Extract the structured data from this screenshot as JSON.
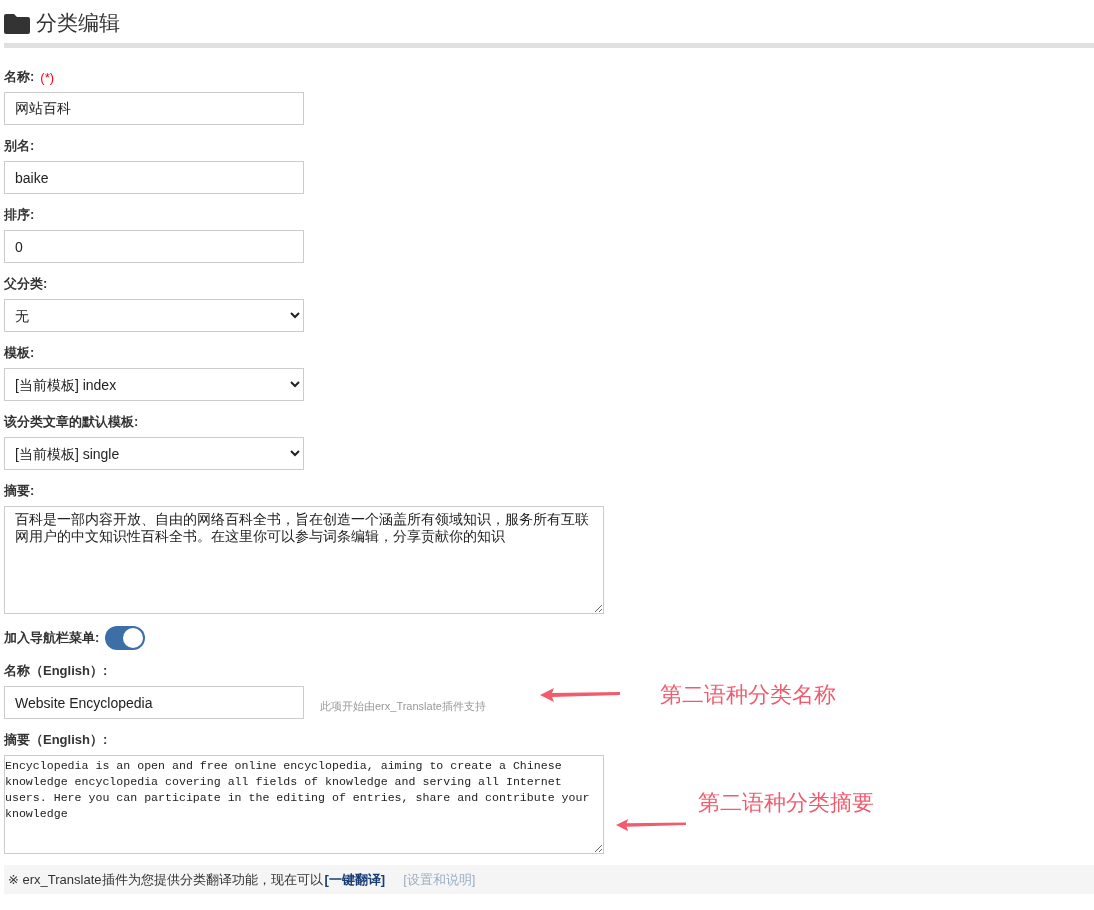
{
  "page_title": "分类编辑",
  "fields": [
    {
      "kind": "input",
      "label": "名称:",
      "required_mark": "(*)",
      "value": "网站百科"
    },
    {
      "kind": "input",
      "label": "别名:",
      "value": "baike"
    },
    {
      "kind": "input",
      "label": "排序:",
      "value": "0"
    },
    {
      "kind": "select",
      "label": "父分类:",
      "value": "无"
    },
    {
      "kind": "select",
      "label": "模板:",
      "value": "[当前模板] index"
    },
    {
      "kind": "select",
      "label": "该分类文章的默认模板:",
      "value": "[当前模板] single"
    },
    {
      "kind": "textarea",
      "label": "摘要:",
      "value": "百科是一部内容开放、自由的网络百科全书，旨在创造一个涵盖所有领域知识，服务所有互联网用户的中文知识性百科全书。在这里你可以参与词条编辑，分享贡献你的知识"
    },
    {
      "kind": "toggle",
      "label": "加入导航栏菜单:",
      "on": true
    },
    {
      "kind": "input",
      "label": "名称（English）:",
      "value": "Website Encyclopedia",
      "hint": "此项开始由erx_Translate插件支持"
    },
    {
      "kind": "mono",
      "label": "摘要（English）:",
      "value": "Encyclopedia is an open and free online encyclopedia, aiming to create a Chinese knowledge encyclopedia covering all fields of knowledge and serving all Internet users. Here you can participate in the editing of entries, share and contribute your knowledge"
    }
  ],
  "annotations": [
    {
      "text": "第二语种分类名称"
    },
    {
      "text": "第二语种分类摘要"
    }
  ],
  "footer": {
    "note": "※ erx_Translate插件为您提供分类翻译功能，现在可以",
    "translate_link": "[一键翻译]",
    "settings_link": "[设置和说明]"
  }
}
